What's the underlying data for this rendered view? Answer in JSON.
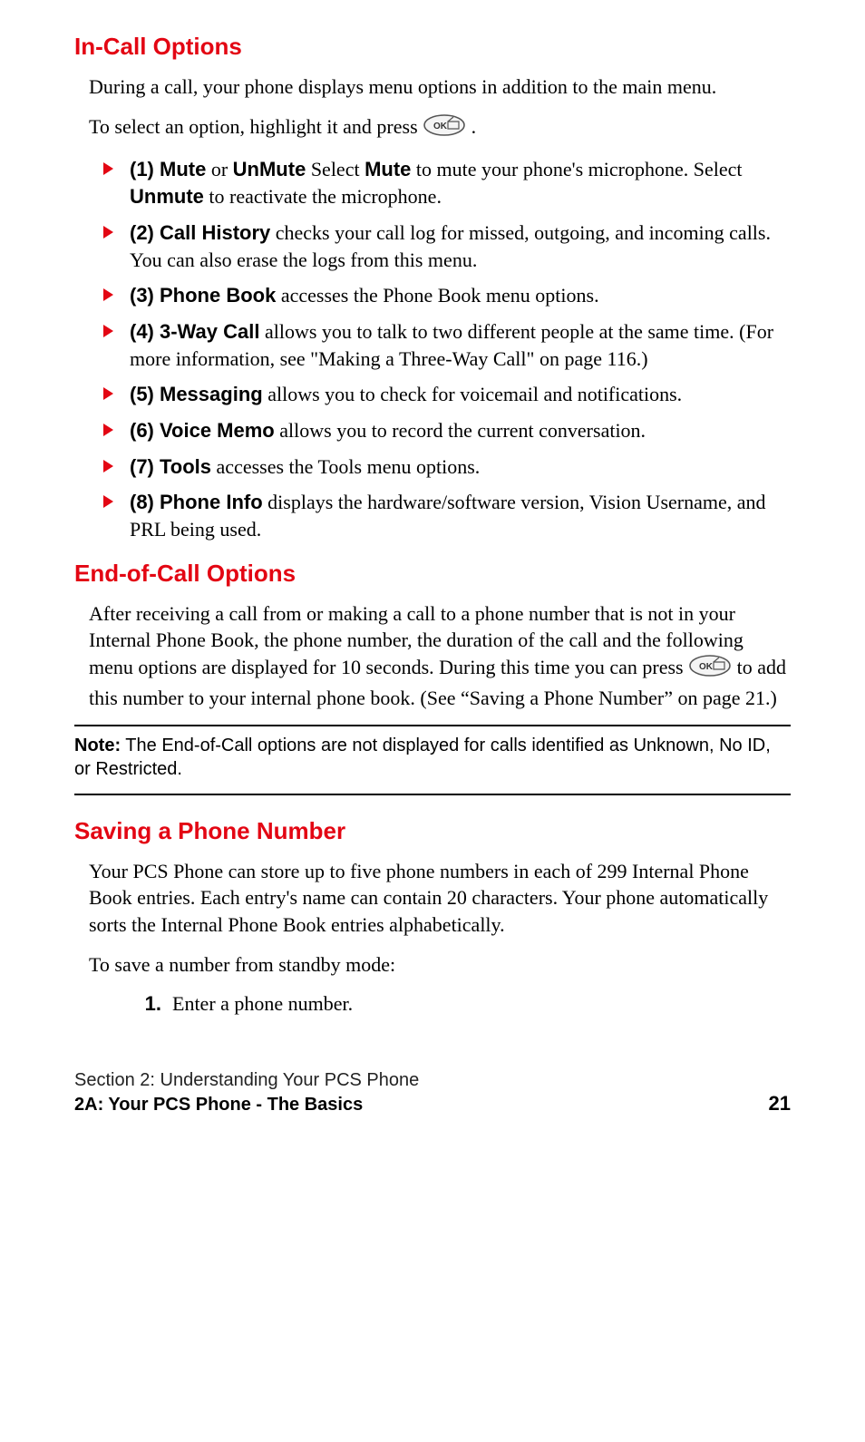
{
  "headings": {
    "incall": "In-Call Options",
    "endcall": "End-of-Call Options",
    "saving": "Saving a Phone Number"
  },
  "incall": {
    "intro": "During a call, your phone displays menu options in addition to the main menu.",
    "select_pre": "To select an option, highlight it and press ",
    "select_post": " .",
    "items": [
      {
        "bold1": "(1) Mute",
        "mid1": " or ",
        "bold2": "UnMute",
        "mid2": " Select ",
        "bold3": "Mute",
        "mid3": " to mute your phone's microphone. Select ",
        "bold4": "Unmute",
        "tail": " to reactivate the microphone."
      },
      {
        "bold1": "(2) Call History",
        "tail": " checks your call log for missed, outgoing, and incoming calls. You can also erase the logs from this menu."
      },
      {
        "bold1": "(3) Phone Book",
        "tail": " accesses the Phone Book menu options."
      },
      {
        "bold1": "(4) 3-Way Call",
        "tail": " allows you to talk to two different people at the same time. (For more information, see \"Making a Three-Way Call\" on page 116.)"
      },
      {
        "bold1": "(5) Messaging",
        "tail": " allows you to check for voicemail and notifications."
      },
      {
        "bold1": "(6) Voice Memo",
        "tail": " allows you to record the current conversation."
      },
      {
        "bold1": "(7) Tools",
        "tail": " accesses the Tools menu options."
      },
      {
        "bold1": "(8) Phone Info",
        "tail": " displays the hardware/software version, Vision Username, and PRL being used."
      }
    ]
  },
  "endcall": {
    "para_pre": "After receiving a call from or making a call to a phone number that is not in your Internal Phone Book, the phone number, the duration of the call and the following menu options are displayed for 10 seconds. During this time you can press ",
    "para_post": " to add this number to your internal phone book. (See “Saving a Phone Number” on page 21.)"
  },
  "note": {
    "label": "Note:",
    "text": " The End-of-Call options are not displayed for calls identified as Unknown, No ID, or Restricted."
  },
  "saving": {
    "para": "Your PCS Phone can store up to five phone numbers in each of 299 Internal Phone Book entries. Each entry's name can contain 20 characters. Your phone automatically sorts the Internal Phone Book entries alphabetically.",
    "lead": "To save a number from standby mode:",
    "step1_num": "1.",
    "step1_text": "Enter a phone number."
  },
  "footer": {
    "section": "Section 2: Understanding Your PCS Phone",
    "chapter": "2A: Your PCS Phone - The Basics",
    "page": "21"
  },
  "icons": {
    "ok_key": "ok-key-icon"
  }
}
